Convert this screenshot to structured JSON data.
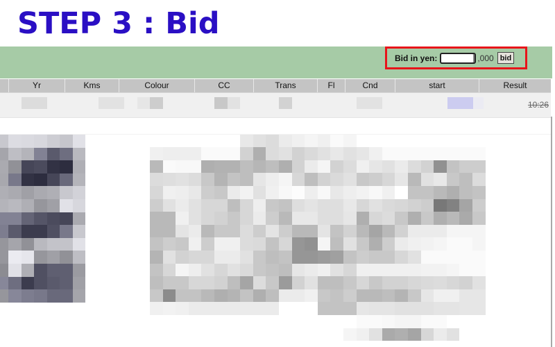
{
  "page": {
    "step_title": "STEP 3 : Bid"
  },
  "bid_form": {
    "label": "Bid in yen:",
    "input_value": "",
    "suffix": ",000",
    "button_label": "bid",
    "highlight_color": "#e8141a"
  },
  "table": {
    "columns": [
      "",
      "Yr",
      "Kms",
      "Colour",
      "CC",
      "Trans",
      "Fl",
      "Cnd",
      "start",
      "Result"
    ],
    "row": {
      "result_time": "10:26",
      "result_struck": true
    }
  },
  "colors": {
    "title": "#2a0fc4",
    "toolbar_green": "#a6cba6",
    "header_gray": "#c4c4c4"
  },
  "redacted_images": {
    "thumbnail": {
      "rows": [
        [
          200,
          220,
          218,
          215,
          205,
          198,
          225
        ],
        [
          165,
          190,
          180,
          130,
          90,
          110,
          185
        ],
        [
          170,
          145,
          70,
          75,
          50,
          45,
          175
        ],
        [
          168,
          120,
          50,
          45,
          70,
          105,
          180
        ],
        [
          175,
          170,
          160,
          170,
          175,
          200,
          210
        ],
        [
          180,
          185,
          175,
          150,
          160,
          225,
          215
        ],
        [
          130,
          130,
          100,
          85,
          75,
          70,
          170
        ],
        [
          125,
          90,
          60,
          60,
          80,
          120,
          200
        ],
        [
          150,
          165,
          145,
          185,
          195,
          195,
          225
        ],
        [
          150,
          235,
          230,
          150,
          160,
          145,
          190
        ],
        [
          140,
          225,
          175,
          80,
          95,
          95,
          155
        ],
        [
          135,
          110,
          60,
          80,
          90,
          95,
          160
        ],
        [
          150,
          135,
          125,
          120,
          105,
          105,
          165
        ]
      ]
    },
    "content": {
      "rows": [
        [
          255,
          255,
          255,
          255,
          255,
          255,
          255,
          255,
          255,
          255,
          255,
          255,
          255,
          255,
          255,
          255,
          255,
          255,
          255,
          255,
          255,
          255,
          255,
          255,
          255,
          255
        ],
        [
          255,
          255,
          255,
          255,
          255,
          255,
          255,
          232,
          225,
          220,
          235,
          240,
          245,
          240,
          250,
          245,
          255,
          255,
          255,
          255,
          255,
          255,
          255,
          255,
          255,
          255
        ],
        [
          240,
          238,
          238,
          238,
          250,
          250,
          250,
          210,
          175,
          220,
          225,
          210,
          218,
          225,
          232,
          225,
          230,
          240,
          250,
          250,
          250,
          250,
          250,
          250,
          250,
          250
        ],
        [
          185,
          250,
          248,
          248,
          175,
          178,
          178,
          190,
          182,
          190,
          175,
          210,
          235,
          245,
          210,
          220,
          240,
          230,
          225,
          235,
          220,
          210,
          145,
          195,
          205,
          205
        ],
        [
          220,
          222,
          225,
          220,
          200,
          180,
          195,
          190,
          230,
          238,
          245,
          215,
          190,
          210,
          218,
          225,
          200,
          205,
          215,
          230,
          185,
          225,
          232,
          200,
          190,
          220
        ],
        [
          215,
          240,
          238,
          232,
          205,
          200,
          235,
          242,
          225,
          240,
          248,
          252,
          238,
          248,
          232,
          238,
          242,
          248,
          240,
          255,
          195,
          195,
          185,
          175,
          190,
          195
        ],
        [
          205,
          225,
          235,
          225,
          215,
          215,
          190,
          215,
          238,
          200,
          195,
          222,
          228,
          222,
          222,
          232,
          215,
          225,
          218,
          215,
          210,
          205,
          120,
          130,
          165,
          205
        ],
        [
          185,
          185,
          240,
          225,
          215,
          210,
          200,
          215,
          235,
          205,
          185,
          232,
          232,
          222,
          222,
          230,
          175,
          215,
          220,
          200,
          175,
          200,
          175,
          185,
          170,
          200
        ],
        [
          185,
          185,
          228,
          235,
          185,
          200,
          200,
          220,
          205,
          228,
          205,
          185,
          185,
          228,
          195,
          210,
          185,
          165,
          185,
          210,
          235,
          235,
          235,
          245,
          245,
          245
        ],
        [
          195,
          205,
          200,
          240,
          205,
          240,
          240,
          220,
          218,
          195,
          215,
          150,
          145,
          245,
          190,
          225,
          200,
          175,
          205,
          235,
          240,
          242,
          245,
          250,
          250,
          245
        ],
        [
          180,
          225,
          210,
          215,
          215,
          235,
          235,
          225,
          200,
          190,
          195,
          150,
          150,
          155,
          160,
          195,
          205,
          200,
          200,
          215,
          225,
          250,
          250,
          250,
          250,
          250
        ],
        [
          195,
          215,
          245,
          238,
          225,
          215,
          225,
          218,
          200,
          195,
          190,
          230,
          235,
          240,
          225,
          215,
          240,
          240,
          240,
          240,
          240,
          242,
          242,
          245,
          250,
          250
        ],
        [
          190,
          200,
          200,
          215,
          215,
          210,
          190,
          165,
          220,
          200,
          155,
          210,
          225,
          190,
          190,
          200,
          215,
          200,
          210,
          210,
          215,
          218,
          220,
          215,
          210,
          225
        ],
        [
          200,
          140,
          195,
          195,
          185,
          175,
          180,
          195,
          175,
          190,
          235,
          235,
          240,
          200,
          195,
          205,
          185,
          185,
          190,
          180,
          200,
          230,
          240,
          240,
          230,
          230
        ],
        [
          240,
          242,
          240,
          235,
          235,
          235,
          235,
          235,
          235,
          235,
          255,
          255,
          255,
          195,
          195,
          195,
          230,
          228,
          228,
          225,
          225,
          225,
          228,
          228,
          230,
          230
        ],
        [
          255,
          255,
          255,
          255,
          255,
          255,
          255,
          255,
          255,
          255,
          255,
          255,
          255,
          255,
          255,
          255,
          250,
          250,
          248,
          245,
          245,
          250,
          250,
          255,
          255,
          255
        ],
        [
          255,
          255,
          255,
          255,
          255,
          255,
          255,
          255,
          255,
          255,
          255,
          255,
          255,
          255,
          255,
          245,
          240,
          225,
          170,
          175,
          165,
          215,
          235,
          225,
          255,
          255
        ]
      ]
    }
  }
}
